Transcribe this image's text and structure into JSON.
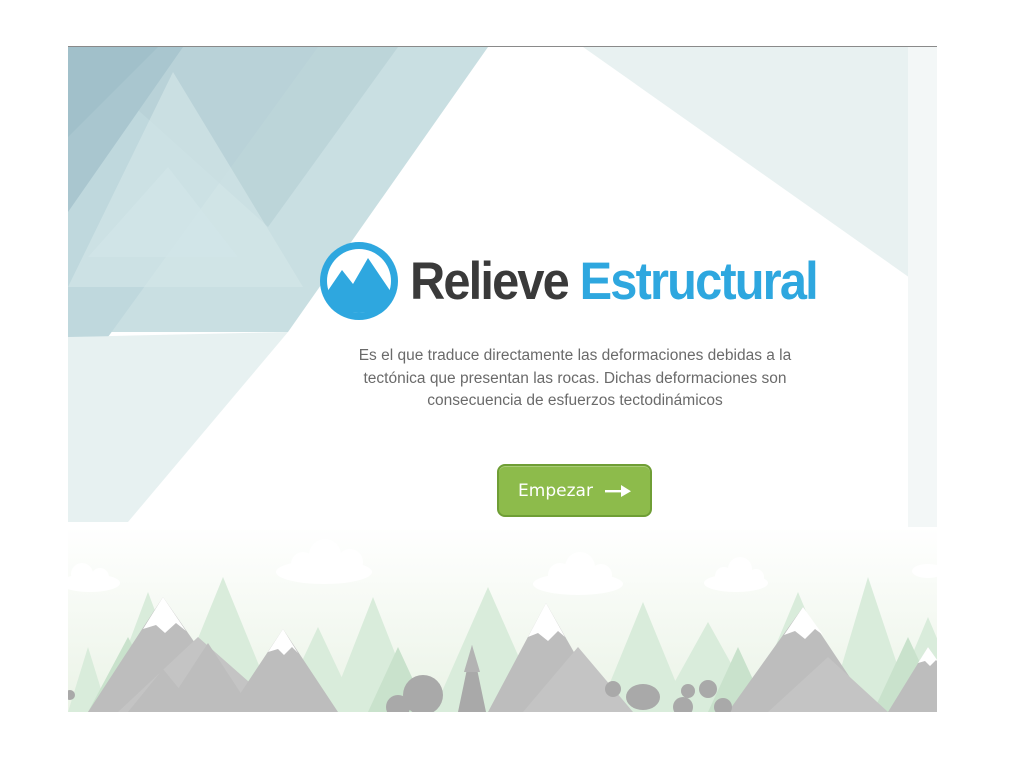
{
  "app": {
    "title": {
      "part1": "Relieve",
      "part2": "Estructural"
    },
    "description": "Es el que traduce directamente las deformaciones debidas a la tectónica que presentan las rocas. Dichas deformaciones son consecuencia de esfuerzos tectodinámicos",
    "start_button": {
      "label": "Empezar",
      "icon": "arrow-right-icon"
    },
    "logo": {
      "icon": "mountain-logo-icon"
    }
  },
  "colors": {
    "brand_blue": "#2ea7df",
    "title_dark": "#3a3a3a",
    "button_green": "#8dbb4b",
    "mountain_gray": "#bdbdbd",
    "tree_green": "#d6ead8"
  }
}
